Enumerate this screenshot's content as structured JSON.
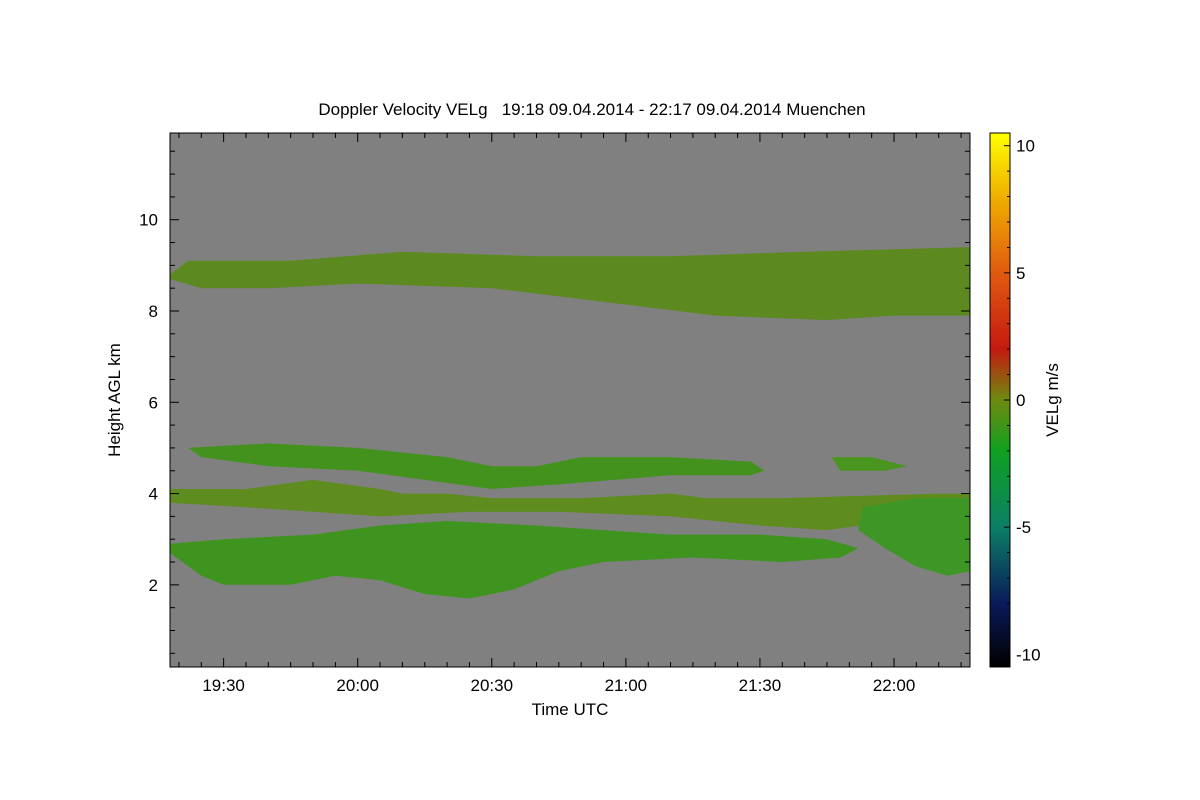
{
  "chart_data": {
    "type": "heatmap",
    "title": "Doppler Velocity VELg   19:18 09.04.2014 - 22:17 09.04.2014 Muenchen",
    "xlabel": "Time UTC",
    "ylabel": "Height AGL km",
    "x_range": [
      "19:18",
      "22:17"
    ],
    "x_ticks": [
      "19:30",
      "20:00",
      "20:30",
      "21:00",
      "21:30",
      "22:00"
    ],
    "ylim": [
      0.2,
      11.9
    ],
    "y_ticks": [
      2,
      4,
      6,
      8,
      10
    ],
    "background_color": "#808080",
    "colorbar": {
      "label": "VELg m/s",
      "range": [
        -10.5,
        10.5
      ],
      "ticks": [
        -10,
        -5,
        0,
        5,
        10
      ],
      "stops": [
        {
          "v": -10.5,
          "color": "#000000"
        },
        {
          "v": -8,
          "color": "#0a1a5a"
        },
        {
          "v": -5,
          "color": "#0b7f66"
        },
        {
          "v": -2,
          "color": "#10a020"
        },
        {
          "v": 0,
          "color": "#6e8a10"
        },
        {
          "v": 2,
          "color": "#c41a10"
        },
        {
          "v": 5,
          "color": "#e05a10"
        },
        {
          "v": 8,
          "color": "#f0b000"
        },
        {
          "v": 10.5,
          "color": "#ffff00"
        }
      ]
    },
    "cloud_layers": [
      {
        "name": "upper",
        "points": [
          [
            "19:18",
            8.8
          ],
          [
            "19:22",
            9.1
          ],
          [
            "19:45",
            9.1
          ],
          [
            "20:10",
            9.3
          ],
          [
            "20:40",
            9.2
          ],
          [
            "21:10",
            9.2
          ],
          [
            "21:40",
            9.3
          ],
          [
            "22:17",
            9.4
          ],
          [
            "22:17",
            7.9
          ],
          [
            "22:00",
            7.9
          ],
          [
            "21:45",
            7.8
          ],
          [
            "21:20",
            7.9
          ],
          [
            "20:55",
            8.2
          ],
          [
            "20:30",
            8.5
          ],
          [
            "20:00",
            8.6
          ],
          [
            "19:40",
            8.5
          ],
          [
            "19:25",
            8.5
          ],
          [
            "19:18",
            8.7
          ]
        ],
        "color": "#5c8a20"
      },
      {
        "name": "mid-high",
        "points": [
          [
            "19:22",
            5.0
          ],
          [
            "19:40",
            5.1
          ],
          [
            "20:00",
            5.0
          ],
          [
            "20:20",
            4.8
          ],
          [
            "20:30",
            4.6
          ],
          [
            "20:40",
            4.6
          ],
          [
            "20:50",
            4.8
          ],
          [
            "21:10",
            4.8
          ],
          [
            "21:28",
            4.7
          ],
          [
            "21:31",
            4.5
          ],
          [
            "21:28",
            4.4
          ],
          [
            "21:10",
            4.4
          ],
          [
            "20:45",
            4.2
          ],
          [
            "20:30",
            4.1
          ],
          [
            "20:15",
            4.3
          ],
          [
            "20:00",
            4.5
          ],
          [
            "19:40",
            4.6
          ],
          [
            "19:25",
            4.8
          ]
        ],
        "color": "#44921e"
      },
      {
        "name": "mid-high-right",
        "points": [
          [
            "21:46",
            4.8
          ],
          [
            "21:55",
            4.8
          ],
          [
            "22:03",
            4.6
          ],
          [
            "21:58",
            4.5
          ],
          [
            "21:48",
            4.5
          ]
        ],
        "color": "#4a9420"
      },
      {
        "name": "mid",
        "points": [
          [
            "19:18",
            4.1
          ],
          [
            "19:35",
            4.1
          ],
          [
            "19:50",
            4.3
          ],
          [
            "20:05",
            4.1
          ],
          [
            "20:10",
            4.0
          ],
          [
            "20:20",
            4.0
          ],
          [
            "20:30",
            3.9
          ],
          [
            "20:50",
            3.9
          ],
          [
            "21:10",
            4.0
          ],
          [
            "21:18",
            3.9
          ],
          [
            "21:35",
            3.9
          ],
          [
            "22:10",
            4.0
          ],
          [
            "22:17",
            4.0
          ],
          [
            "22:17",
            3.5
          ],
          [
            "22:00",
            3.4
          ],
          [
            "21:45",
            3.2
          ],
          [
            "21:30",
            3.3
          ],
          [
            "21:10",
            3.5
          ],
          [
            "20:45",
            3.6
          ],
          [
            "20:25",
            3.6
          ],
          [
            "20:05",
            3.5
          ],
          [
            "19:50",
            3.6
          ],
          [
            "19:35",
            3.7
          ],
          [
            "19:18",
            3.8
          ]
        ],
        "color": "#5e8c1e"
      },
      {
        "name": "lower",
        "points": [
          [
            "19:18",
            2.9
          ],
          [
            "19:30",
            3.0
          ],
          [
            "19:50",
            3.1
          ],
          [
            "20:05",
            3.3
          ],
          [
            "20:20",
            3.4
          ],
          [
            "20:40",
            3.3
          ],
          [
            "20:55",
            3.2
          ],
          [
            "21:10",
            3.1
          ],
          [
            "21:30",
            3.1
          ],
          [
            "21:45",
            3.0
          ],
          [
            "21:52",
            2.8
          ],
          [
            "21:48",
            2.6
          ],
          [
            "21:35",
            2.5
          ],
          [
            "21:15",
            2.6
          ],
          [
            "20:55",
            2.5
          ],
          [
            "20:45",
            2.3
          ],
          [
            "20:35",
            1.9
          ],
          [
            "20:25",
            1.7
          ],
          [
            "20:15",
            1.8
          ],
          [
            "20:05",
            2.1
          ],
          [
            "19:55",
            2.2
          ],
          [
            "19:45",
            2.0
          ],
          [
            "19:30",
            2.0
          ],
          [
            "19:25",
            2.2
          ],
          [
            "19:18",
            2.7
          ]
        ],
        "color": "#3f9420"
      },
      {
        "name": "lower-right",
        "points": [
          [
            "21:53",
            3.7
          ],
          [
            "22:05",
            3.9
          ],
          [
            "22:17",
            3.9
          ],
          [
            "22:17",
            2.3
          ],
          [
            "22:12",
            2.2
          ],
          [
            "22:05",
            2.4
          ],
          [
            "21:58",
            2.8
          ],
          [
            "21:52",
            3.2
          ]
        ],
        "color": "#3e9626"
      }
    ]
  }
}
